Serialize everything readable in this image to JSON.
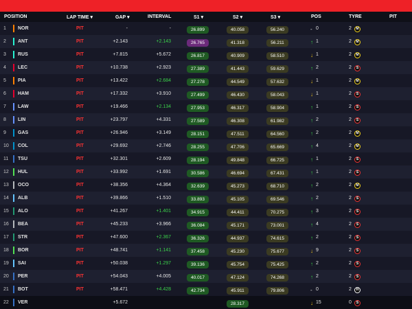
{
  "header": {
    "position": "POSITION",
    "lap_time": "LAP TIME",
    "gap": "GAP",
    "interval": "INTERVAL",
    "s1": "S1",
    "s2": "S2",
    "s3": "S3",
    "pos": "POS",
    "tyre": "TYRE",
    "pit": "PIT"
  },
  "rows": [
    {
      "pos": "1",
      "driver": "NOR",
      "team_color": "#ff8000",
      "lap": "PIT",
      "gap": "-",
      "interval": "-",
      "interval_green": false,
      "s1": "26.899",
      "s1c": "g",
      "s2": "40.058",
      "s2c": "y",
      "s3": "56.240",
      "s3c": "y",
      "dir": "dash",
      "change": "0",
      "tyre_age": "2",
      "tyre": "M"
    },
    {
      "pos": "2",
      "driver": "ANT",
      "team_color": "#27f4d2",
      "lap": "PIT",
      "gap": "+2.143",
      "interval": "+2.143",
      "interval_green": true,
      "s1": "26.765",
      "s1c": "p",
      "s2": "41.318",
      "s2c": "y",
      "s3": "56.211",
      "s3c": "y",
      "dir": "up",
      "change": "1",
      "tyre_age": "2",
      "tyre": "M"
    },
    {
      "pos": "3",
      "driver": "RUS",
      "team_color": "#27f4d2",
      "lap": "PIT",
      "gap": "+7.815",
      "interval": "+5.672",
      "interval_green": false,
      "s1": "26.817",
      "s1c": "g",
      "s2": "40.909",
      "s2c": "y",
      "s3": "58.510",
      "s3c": "y",
      "dir": "down",
      "change": "1",
      "tyre_age": "2",
      "tyre": "M"
    },
    {
      "pos": "4",
      "driver": "LEC",
      "team_color": "#e8002d",
      "lap": "PIT",
      "gap": "+10.738",
      "interval": "+2.923",
      "interval_green": false,
      "s1": "27.389",
      "s1c": "g",
      "s2": "41.443",
      "s2c": "y",
      "s3": "59.629",
      "s3c": "y",
      "dir": "up",
      "change": "2",
      "tyre_age": "2",
      "tyre": "S"
    },
    {
      "pos": "5",
      "driver": "PIA",
      "team_color": "#ff8000",
      "lap": "PIT",
      "gap": "+13.422",
      "interval": "+2.684",
      "interval_green": true,
      "s1": "27.278",
      "s1c": "g",
      "s2": "44.549",
      "s2c": "y",
      "s3": "57.632",
      "s3c": "y",
      "dir": "down",
      "change": "1",
      "tyre_age": "2",
      "tyre": "M"
    },
    {
      "pos": "6",
      "driver": "HAM",
      "team_color": "#e8002d",
      "lap": "PIT",
      "gap": "+17.332",
      "interval": "+3.910",
      "interval_green": false,
      "s1": "27.499",
      "s1c": "g",
      "s2": "46.430",
      "s2c": "y",
      "s3": "58.043",
      "s3c": "y",
      "dir": "down",
      "change": "1",
      "tyre_age": "2",
      "tyre": "S"
    },
    {
      "pos": "7",
      "driver": "LAW",
      "team_color": "#6692ff",
      "lap": "PIT",
      "gap": "+19.466",
      "interval": "+2.134",
      "interval_green": true,
      "s1": "27.953",
      "s1c": "g",
      "s2": "46.317",
      "s2c": "y",
      "s3": "58.904",
      "s3c": "y",
      "dir": "up",
      "change": "1",
      "tyre_age": "2",
      "tyre": "S"
    },
    {
      "pos": "8",
      "driver": "LIN",
      "team_color": "#6692ff",
      "lap": "PIT",
      "gap": "+23.797",
      "interval": "+4.331",
      "interval_green": false,
      "s1": "27.589",
      "s1c": "g",
      "s2": "46.308",
      "s2c": "y",
      "s3": "61.982",
      "s3c": "y",
      "dir": "up",
      "change": "2",
      "tyre_age": "2",
      "tyre": "S"
    },
    {
      "pos": "9",
      "driver": "GAS",
      "team_color": "#0093cc",
      "lap": "PIT",
      "gap": "+26.946",
      "interval": "+3.149",
      "interval_green": false,
      "s1": "28.151",
      "s1c": "g",
      "s2": "47.511",
      "s2c": "y",
      "s3": "64.560",
      "s3c": "y",
      "dir": "up",
      "change": "2",
      "tyre_age": "2",
      "tyre": "M"
    },
    {
      "pos": "10",
      "driver": "COL",
      "team_color": "#0093cc",
      "lap": "PIT",
      "gap": "+29.692",
      "interval": "+2.746",
      "interval_green": false,
      "s1": "28.255",
      "s1c": "g",
      "s2": "47.706",
      "s2c": "y",
      "s3": "65.669",
      "s3c": "y",
      "dir": "up",
      "change": "4",
      "tyre_age": "2",
      "tyre": "M"
    },
    {
      "pos": "11",
      "driver": "TSU",
      "team_color": "#3671c6",
      "lap": "PIT",
      "gap": "+32.301",
      "interval": "+2.609",
      "interval_green": false,
      "s1": "28.194",
      "s1c": "g",
      "s2": "49.848",
      "s2c": "y",
      "s3": "66.725",
      "s3c": "y",
      "dir": "up",
      "change": "1",
      "tyre_age": "2",
      "tyre": "S"
    },
    {
      "pos": "12",
      "driver": "HUL",
      "team_color": "#52e252",
      "lap": "PIT",
      "gap": "+33.992",
      "interval": "+1.691",
      "interval_green": false,
      "s1": "30.586",
      "s1c": "g",
      "s2": "46.694",
      "s2c": "y",
      "s3": "67.431",
      "s3c": "y",
      "dir": "up",
      "change": "1",
      "tyre_age": "2",
      "tyre": "S"
    },
    {
      "pos": "13",
      "driver": "OCO",
      "team_color": "#b6babd",
      "lap": "PIT",
      "gap": "+38.356",
      "interval": "+4.364",
      "interval_green": false,
      "s1": "32.639",
      "s1c": "g",
      "s2": "45.273",
      "s2c": "y",
      "s3": "68.710",
      "s3c": "y",
      "dir": "up",
      "change": "2",
      "tyre_age": "2",
      "tyre": "M"
    },
    {
      "pos": "14",
      "driver": "ALB",
      "team_color": "#64c4ff",
      "lap": "PIT",
      "gap": "+39.866",
      "interval": "+1.510",
      "interval_green": false,
      "s1": "33.893",
      "s1c": "g",
      "s2": "45.105",
      "s2c": "y",
      "s3": "69.546",
      "s3c": "y",
      "dir": "up",
      "change": "2",
      "tyre_age": "2",
      "tyre": "S"
    },
    {
      "pos": "15",
      "driver": "ALO",
      "team_color": "#229971",
      "lap": "PIT",
      "gap": "+41.267",
      "interval": "+1.401",
      "interval_green": true,
      "s1": "34.915",
      "s1c": "g",
      "s2": "44.411",
      "s2c": "y",
      "s3": "70.275",
      "s3c": "y",
      "dir": "up",
      "change": "3",
      "tyre_age": "2",
      "tyre": "S"
    },
    {
      "pos": "16",
      "driver": "BEA",
      "team_color": "#b6babd",
      "lap": "PIT",
      "gap": "+45.233",
      "interval": "+3.966",
      "interval_green": false,
      "s1": "36.084",
      "s1c": "g",
      "s2": "45.171",
      "s2c": "y",
      "s3": "73.001",
      "s3c": "y",
      "dir": "up",
      "change": "4",
      "tyre_age": "2",
      "tyre": "S"
    },
    {
      "pos": "17",
      "driver": "STR",
      "team_color": "#229971",
      "lap": "PIT",
      "gap": "+47.600",
      "interval": "+2.367",
      "interval_green": true,
      "s1": "36.326",
      "s1c": "g",
      "s2": "44.937",
      "s2c": "y",
      "s3": "74.615",
      "s3c": "y",
      "dir": "up",
      "change": "2",
      "tyre_age": "2",
      "tyre": "S"
    },
    {
      "pos": "18",
      "driver": "BOR",
      "team_color": "#52e252",
      "lap": "PIT",
      "gap": "+48.741",
      "interval": "+1.141",
      "interval_green": true,
      "s1": "37.458",
      "s1c": "g",
      "s2": "45.230",
      "s2c": "y",
      "s3": "75.677",
      "s3c": "y",
      "dir": "down",
      "change": "9",
      "tyre_age": "2",
      "tyre": "S"
    },
    {
      "pos": "19",
      "driver": "SAI",
      "team_color": "#64c4ff",
      "lap": "PIT",
      "gap": "+50.038",
      "interval": "+1.297",
      "interval_green": true,
      "s1": "39.136",
      "s1c": "g",
      "s2": "45.754",
      "s2c": "y",
      "s3": "75.425",
      "s3c": "y",
      "dir": "up",
      "change": "2",
      "tyre_age": "2",
      "tyre": "S"
    },
    {
      "pos": "20",
      "driver": "PER",
      "team_color": "#3671c6",
      "lap": "PIT",
      "gap": "+54.043",
      "interval": "+4.005",
      "interval_green": false,
      "s1": "40.017",
      "s1c": "g",
      "s2": "47.124",
      "s2c": "y",
      "s3": "74.268",
      "s3c": "y",
      "dir": "up",
      "change": "2",
      "tyre_age": "2",
      "tyre": "S"
    },
    {
      "pos": "21",
      "driver": "BOT",
      "team_color": "#3671c6",
      "lap": "PIT",
      "gap": "+58.471",
      "interval": "+4.428",
      "interval_green": true,
      "s1": "42.734",
      "s1c": "g",
      "s2": "45.911",
      "s2c": "y",
      "s3": "79.806",
      "s3c": "y",
      "dir": "dash",
      "change": "0",
      "tyre_age": "2",
      "tyre": "H"
    },
    {
      "pos": "22",
      "driver": "VER",
      "team_color": "#3671c6",
      "lap": "",
      "gap": "+5.672",
      "interval": "",
      "interval_green": false,
      "s1": "",
      "s1c": "",
      "s2": "28.317",
      "s2c": "g",
      "s3": "",
      "s3c": "",
      "dir": "down",
      "change": "15",
      "tyre_age": "0",
      "tyre": "S",
      "highlight": true
    }
  ]
}
